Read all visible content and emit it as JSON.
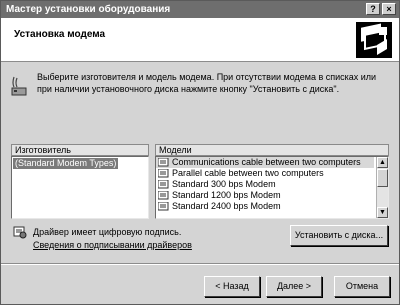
{
  "window": {
    "title": "Мастер установки оборудования",
    "buttons": [
      "?",
      "×"
    ]
  },
  "header": {
    "title": "Установка модема",
    "icon": "hardware-wizard-icon"
  },
  "info": {
    "icon": "modem-icon",
    "text": "Выберите изготовителя и модель модема. При отсутствии модема в списках или при наличии установочного диска нажмите кнопку \"Установить с диска\"."
  },
  "manufacturers": {
    "header": "Изготовитель",
    "items": [
      "(Standard Modem Types)"
    ],
    "selected": "(Standard Modem Types)"
  },
  "models": {
    "header": "Модели",
    "items": [
      "Communications cable between two computers",
      "Parallel cable between two computers",
      "Standard   300 bps Modem",
      "Standard   1200 bps Modem",
      "Standard   2400 bps Modem"
    ]
  },
  "signature": {
    "icon": "signed-driver-icon",
    "text": "Драйвер имеет цифровую подпись.",
    "link": "Сведения о подписывании драйверов"
  },
  "buttons": {
    "have_disk": "Установить с диска...",
    "back": "< Назад",
    "next": "Далее >",
    "cancel": "Отмена"
  }
}
